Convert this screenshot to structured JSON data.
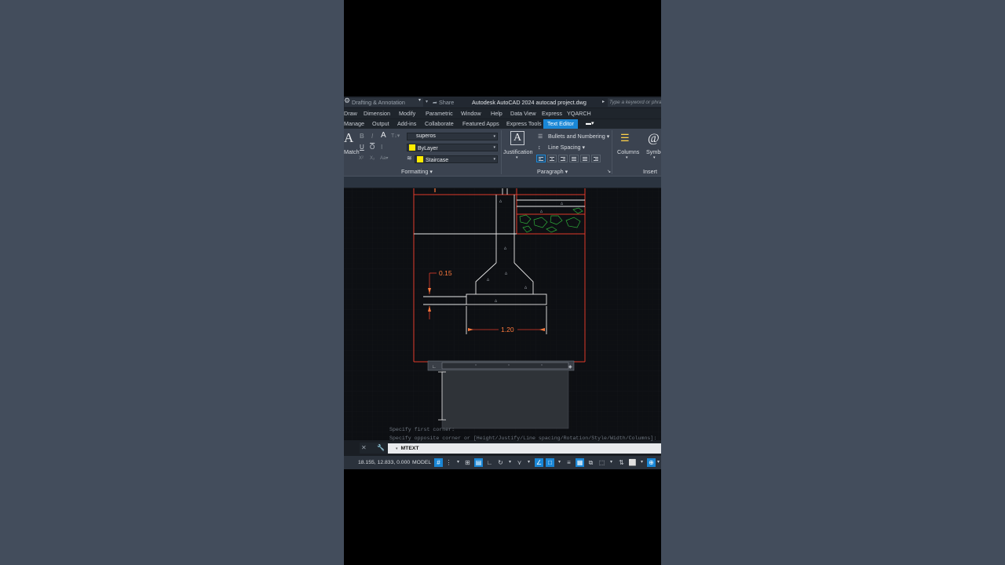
{
  "titlebar": {
    "workspace": "Drafting & Annotation",
    "share": "Share",
    "app_title": "Autodesk AutoCAD 2024   autocad project.dwg",
    "search_placeholder": "Type a keyword or phrase"
  },
  "menu": [
    "Draw",
    "Dimension",
    "Modify",
    "Parametric",
    "Window",
    "Help",
    "Data View",
    "Express",
    "YQARCH"
  ],
  "ribbon_tabs": [
    "Manage",
    "Output",
    "Add-ins",
    "Collaborate",
    "Featured Apps",
    "Express Tools",
    "Text Editor"
  ],
  "ribbon": {
    "match_label": "Match",
    "text_style": "superos",
    "color": "ByLayer",
    "layer": "Staircase",
    "formatting_label": "Formatting",
    "justification_label": "Justification",
    "bullets_label": "Bullets and Numbering",
    "line_spacing_label": "Line Spacing",
    "paragraph_label": "Paragraph",
    "columns_label": "Columns",
    "symbol_label": "Symbol",
    "insert_label": "Insert",
    "symbol_glyph": "@",
    "justification_glyph": "A",
    "match_glyph": "A"
  },
  "drawing": {
    "dim_height": "0.15",
    "dim_width": "1.20",
    "colors": {
      "red": "#e03a2a",
      "white": "#e8e8e8",
      "orange": "#ff7a3d",
      "green": "#2fae3a"
    }
  },
  "command": {
    "history": [
      "Specify first corner:",
      "Specify opposite corner or [Height/Justify/Line spacing/Rotation/Style/Width/Columns]:"
    ],
    "current": "MTEXT"
  },
  "status": {
    "coords": "18.155, 12.833, 0.000",
    "model": "MODEL"
  }
}
